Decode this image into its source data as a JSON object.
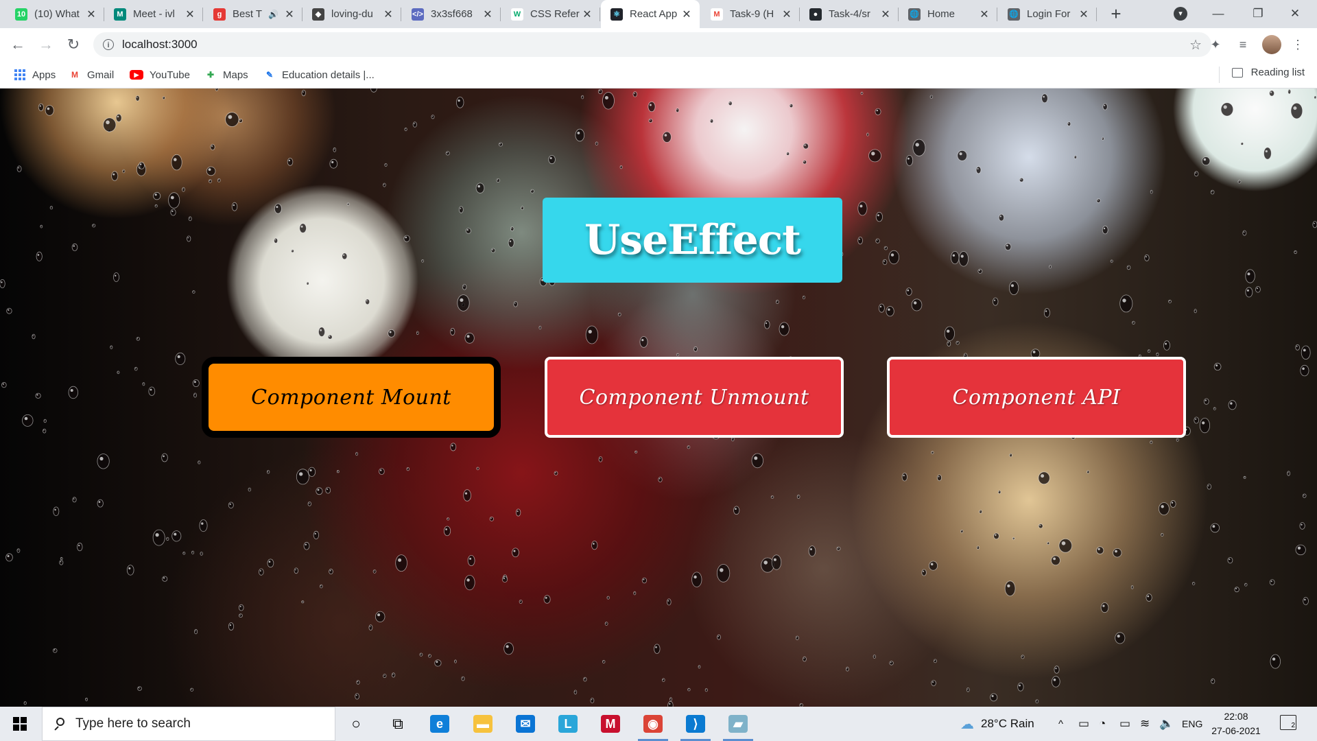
{
  "browser": {
    "tabs": [
      {
        "title": "(10) What",
        "fav_text": "10",
        "fav_color": "#25d366",
        "active": false
      },
      {
        "title": "Meet - ivl",
        "fav_text": "M",
        "fav_color": "#00897b",
        "active": false
      },
      {
        "title": "Best T",
        "fav_text": "g",
        "fav_color": "#e53935",
        "active": false,
        "audio": "🔊"
      },
      {
        "title": "loving-du",
        "fav_text": "◆",
        "fav_color": "#444444",
        "active": false
      },
      {
        "title": "3x3sf668",
        "fav_text": "</>",
        "fav_color": "#5c6bc0",
        "active": false
      },
      {
        "title": "CSS Refer",
        "fav_text": "W",
        "fav_color": "#ffffff",
        "fav_fg": "#04aa6d",
        "active": false
      },
      {
        "title": "React App",
        "fav_text": "⚛",
        "fav_color": "#20232a",
        "fav_fg": "#61dafb",
        "active": true
      },
      {
        "title": "Task-9 (H",
        "fav_text": "M",
        "fav_color": "#ffffff",
        "fav_fg": "#ea4335",
        "active": false
      },
      {
        "title": "Task-4/sr",
        "fav_text": "●",
        "fav_color": "#24292e",
        "active": false
      },
      {
        "title": "Home",
        "fav_text": "🌐",
        "fav_color": "#5f6368",
        "active": false
      },
      {
        "title": "Login For",
        "fav_text": "🌐",
        "fav_color": "#5f6368",
        "active": false
      }
    ],
    "close_glyph": "✕",
    "new_tab": "+",
    "tab_search": "▾",
    "window_controls": {
      "minimize": "—",
      "maximize": "❐",
      "close": "✕"
    },
    "nav": {
      "back": "←",
      "forward": "→",
      "reload": "↻"
    },
    "address": {
      "url": "localhost:3000",
      "info": "i",
      "star": "☆"
    },
    "toolbar_icons": {
      "extensions": "✦",
      "media": "≡",
      "menu": "⋮"
    },
    "bookmarks": [
      {
        "label": "Apps",
        "icon": "apps-grid-icon"
      },
      {
        "label": "Gmail",
        "icon": "gmail-icon",
        "glyph": "M",
        "color": "#ea4335"
      },
      {
        "label": "YouTube",
        "icon": "youtube-icon",
        "glyph": "▶",
        "color": "#ff0000"
      },
      {
        "label": "Maps",
        "icon": "maps-icon",
        "glyph": "✚",
        "color": "#34a853"
      },
      {
        "label": "Education details |...",
        "icon": "education-icon",
        "glyph": "✎",
        "color": "#1a73e8"
      }
    ],
    "reading_list": "Reading list"
  },
  "page": {
    "heading": "UseEffect",
    "buttons": {
      "mount": "Component Mount",
      "unmount": "Component Unmount",
      "api": "Component API"
    },
    "colors": {
      "heading_bg": "#36d7ec",
      "mount_bg": "#ff8c00",
      "unmount_bg": "#e5333b",
      "api_bg": "#e5333b"
    }
  },
  "taskbar": {
    "search_placeholder": "Type here to search",
    "apps": [
      {
        "name": "cortana-icon",
        "glyph": "○"
      },
      {
        "name": "task-view-icon",
        "glyph": "⧉"
      },
      {
        "name": "edge-icon",
        "glyph": "e",
        "color": "#0f7fd9"
      },
      {
        "name": "file-explorer-icon",
        "glyph": "▬",
        "color": "#f6c23e"
      },
      {
        "name": "mail-icon",
        "glyph": "✉",
        "color": "#0a74d4"
      },
      {
        "name": "launcher-l-icon",
        "glyph": "L",
        "color": "#2aa6d9"
      },
      {
        "name": "mcafee-icon",
        "glyph": "M",
        "color": "#c8102e"
      },
      {
        "name": "chrome-icon",
        "glyph": "◉",
        "color": "#db4437"
      },
      {
        "name": "vscode-icon",
        "glyph": "⟩",
        "color": "#0a7ad1"
      },
      {
        "name": "app-window-icon",
        "glyph": "▰",
        "color": "#7fb2c9"
      }
    ],
    "weather": "28°C  Rain",
    "tray_icons": {
      "chevron": "^",
      "meet": "▭",
      "network": "◔",
      "battery": "▭",
      "wifi": "≋",
      "volume": "🔈"
    },
    "language": "ENG",
    "time": "22:08",
    "date": "27-06-2021",
    "notification_count": "2"
  }
}
